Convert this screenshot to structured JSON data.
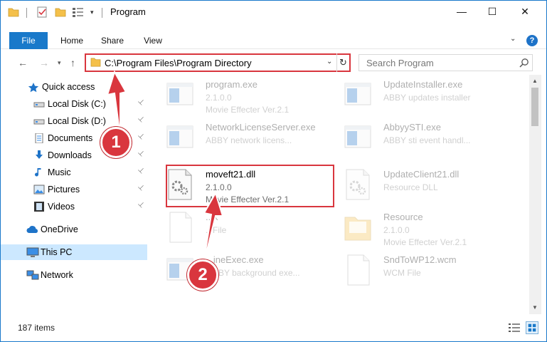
{
  "window": {
    "title": "Program"
  },
  "titlebar": {
    "minimize": "—",
    "maximize": "☐",
    "close": "✕",
    "quick_access_dropdown": "▾"
  },
  "ribbon": {
    "tabs": [
      "File",
      "Home",
      "Share",
      "View"
    ],
    "expand": "⌄",
    "help": "?"
  },
  "nav": {
    "back": "←",
    "forward": "→",
    "recent": "▾",
    "up": "↑",
    "address": "C:\\Program Files\\Program Directory",
    "address_dropdown": "⌄",
    "refresh": "↻",
    "search_placeholder": "Search Program"
  },
  "sidebar": {
    "items": [
      {
        "label": "Quick access",
        "icon": "star-icon",
        "pinned": false
      },
      {
        "label": "Local Disk (C:)",
        "icon": "drive-icon",
        "pinned": true
      },
      {
        "label": "Local Disk (D:)",
        "icon": "drive-icon",
        "pinned": true
      },
      {
        "label": "Documents",
        "icon": "documents-icon",
        "pinned": true
      },
      {
        "label": "Downloads",
        "icon": "downloads-icon",
        "pinned": true
      },
      {
        "label": "Music",
        "icon": "music-icon",
        "pinned": true
      },
      {
        "label": "Pictures",
        "icon": "pictures-icon",
        "pinned": true
      },
      {
        "label": "Videos",
        "icon": "videos-icon",
        "pinned": true
      },
      {
        "label": "OneDrive",
        "icon": "cloud-icon",
        "pinned": false
      },
      {
        "label": "This PC",
        "icon": "computer-icon",
        "pinned": false,
        "selected": true
      },
      {
        "label": "Network",
        "icon": "network-icon",
        "pinned": false
      }
    ],
    "pin_glyph": "📌"
  },
  "files": [
    {
      "name": "program.exe",
      "line2": "2.1.0.0",
      "line3": "Movie Effecter Ver.2.1",
      "icon": "exe-icon",
      "faded": true
    },
    {
      "name": "UpdateInstaller.exe",
      "line2": "ABBY updates installer",
      "line3": "",
      "icon": "exe-icon",
      "faded": true
    },
    {
      "name": "NetworkLicenseServer.exe",
      "line2": "ABBY network licens...",
      "line3": "",
      "icon": "exe-icon",
      "faded": true
    },
    {
      "name": "AbbyySTI.exe",
      "line2": "ABBY sti event handl...",
      "line3": "",
      "icon": "exe-icon",
      "faded": true
    },
    {
      "name": "moveft21.dll",
      "line2": "2.1.0.0",
      "line3": "Movie Effecter Ver.2.1",
      "icon": "dll-icon",
      "faded": false
    },
    {
      "name": "UpdateClient21.dll",
      "line2": "Resource DLL",
      "line3": "",
      "icon": "dll-icon",
      "faded": true
    },
    {
      "name": "...k",
      "line2": "...File",
      "line3": "",
      "icon": "file-icon",
      "faded": true
    },
    {
      "name": "Resource",
      "line2": "2.1.0.0",
      "line3": "Movie Effecter Ver.2.1",
      "icon": "folder-icon",
      "faded": true
    },
    {
      "name": "...ineExec.exe",
      "line2": "...BBY background exe...",
      "line3": "",
      "icon": "exe-icon",
      "faded": true
    },
    {
      "name": "SndToWP12.wcm",
      "line2": "WCM File",
      "line3": "",
      "icon": "file-icon",
      "faded": true
    }
  ],
  "status": {
    "item_count": "187 items"
  },
  "annotations": {
    "step1": "1",
    "step2": "2",
    "color": "#d9363e"
  },
  "colors": {
    "accent": "#1979ca",
    "selected": "#cce8ff",
    "highlight": "#d9363e"
  }
}
